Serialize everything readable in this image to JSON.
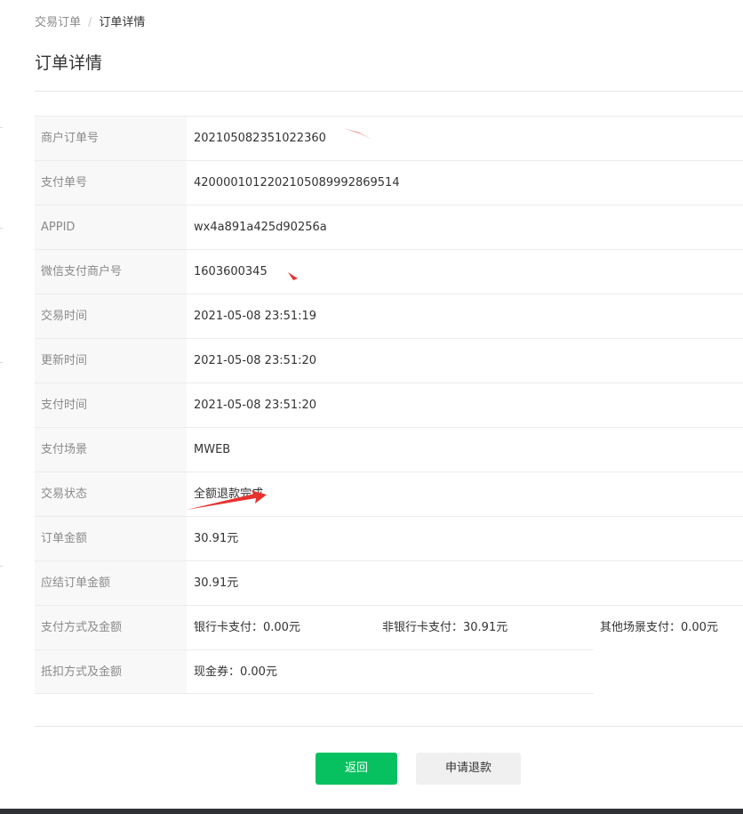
{
  "breadcrumb": {
    "parent": "交易订单",
    "separator": "/",
    "current": "订单详情"
  },
  "page": {
    "title": "订单详情"
  },
  "details": [
    {
      "label": "商户订单号",
      "value": "202105082351022360"
    },
    {
      "label": "支付单号",
      "value": "4200001012202105089992869514"
    },
    {
      "label": "APPID",
      "value": "wx4a891a425d90256a"
    },
    {
      "label": "微信支付商户号",
      "value": "1603600345"
    },
    {
      "label": "交易时间",
      "value": "2021-05-08 23:51:19"
    },
    {
      "label": "更新时间",
      "value": "2021-05-08 23:51:20"
    },
    {
      "label": "支付时间",
      "value": "2021-05-08 23:51:20"
    },
    {
      "label": "支付场景",
      "value": "MWEB"
    },
    {
      "label": "交易状态",
      "value": "全额退款完成"
    },
    {
      "label": "订单金额",
      "value": "30.91元"
    },
    {
      "label": "应结订单金额",
      "value": "30.91元"
    }
  ],
  "payment_methods": {
    "label": "支付方式及金额",
    "bank_card": "银行卡支付：0.00元",
    "non_bank_card": "非银行卡支付：30.91元",
    "other_scene": "其他场景支付：0.00元"
  },
  "deduction": {
    "label": "抵扣方式及金额",
    "value": "现金券：0.00元"
  },
  "actions": {
    "back_label": "返回",
    "refund_label": "申请退款"
  },
  "colors": {
    "primary_green": "#07c160",
    "annotation_red": "#e8322f"
  }
}
